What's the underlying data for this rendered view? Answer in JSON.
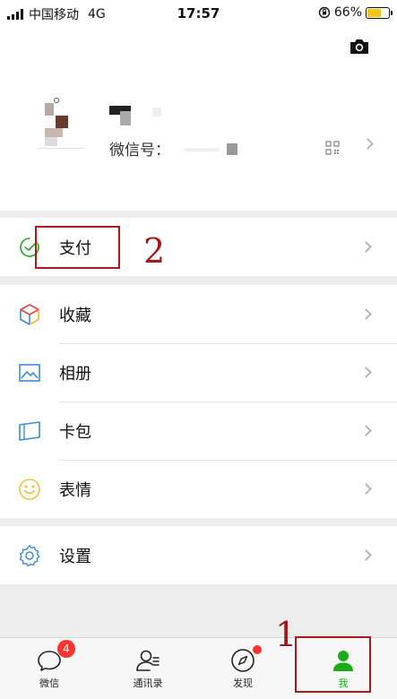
{
  "status_bar": {
    "carrier": "中国移动",
    "network": "4G",
    "time": "17:57",
    "battery": "66%",
    "battery_level": 0.66
  },
  "profile": {
    "wechat_id_label": "微信号："
  },
  "menu": {
    "pay": "支付",
    "favorites": "收藏",
    "album": "相册",
    "cards": "卡包",
    "stickers": "表情",
    "settings": "设置"
  },
  "tabs": [
    {
      "label": "微信",
      "icon": "chat-bubble-icon",
      "badge": "4"
    },
    {
      "label": "通讯录",
      "icon": "contacts-icon"
    },
    {
      "label": "发现",
      "icon": "compass-icon"
    },
    {
      "label": "我",
      "icon": "me-icon"
    }
  ],
  "annotations": {
    "step1": "1",
    "step2": "2"
  },
  "colors": {
    "accent": "#1aad19",
    "annotation": "#b0161a",
    "badge": "#f43530",
    "battery": "#f6c21c"
  }
}
